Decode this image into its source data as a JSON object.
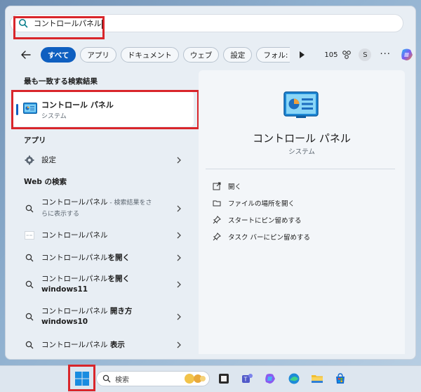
{
  "search": {
    "query": "コントロールパネル"
  },
  "filters": {
    "chips": [
      "すべて",
      "アプリ",
      "ドキュメント",
      "ウェブ",
      "設定",
      "フォル:"
    ],
    "points": "105",
    "avatar_letter": "S",
    "more": "···"
  },
  "left": {
    "best_match_title": "最も一致する検索結果",
    "best_match": {
      "name": "コントロール パネル",
      "type": "システム"
    },
    "apps_title": "アプリ",
    "apps": [
      {
        "label": "設定"
      }
    ],
    "web_title": "Web の検索",
    "web": [
      {
        "main": "コントロールパネル",
        "suffix": " - 検索結果をさ",
        "line2": "らに表示する"
      },
      {
        "main": "コントロールパネル"
      },
      {
        "main": "コントロールパネル",
        "bold": "を開く"
      },
      {
        "main": "コントロールパネル",
        "bold": "を開く",
        "line2": "windows11"
      },
      {
        "main": "コントロールパネル ",
        "bold": "開き方",
        "line2": "windows10"
      },
      {
        "main": "コントロールパネル ",
        "bold": "表示"
      }
    ]
  },
  "right": {
    "title": "コントロール パネル",
    "subtitle": "システム",
    "actions": [
      "開く",
      "ファイルの場所を開く",
      "スタートにピン留めする",
      "タスク バーにピン留めする"
    ]
  },
  "taskbar": {
    "search_label": "検索"
  },
  "colors": {
    "accent": "#0f5fc0",
    "highlight": "#d9262b"
  }
}
